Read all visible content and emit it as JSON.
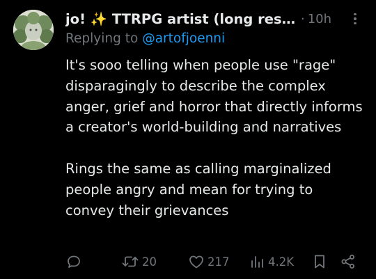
{
  "tweet": {
    "display_name": "jo! ✨ TTRPG artist (long resti...",
    "separator": "·",
    "timestamp": "10h",
    "replying_prefix": "Replying to",
    "replying_handle": "@artofjoenni",
    "paragraphs": [
      "It's sooo telling when people use \"rage\" disparagingly to describe the complex anger, grief and horror that directly informs a creator's world-building and narratives",
      "Rings the same as calling marginalized people angry and mean for trying to convey their grievances"
    ]
  },
  "actions": {
    "reply_icon": "speech-bubble-icon",
    "retweet_icon": "retweet-icon",
    "retweets": "20",
    "like_icon": "heart-icon",
    "likes": "217",
    "views_icon": "bar-chart-icon",
    "views": "4.2K",
    "bookmark_icon": "bookmark-icon",
    "share_icon": "share-icon"
  },
  "colors": {
    "background": "#000000",
    "text": "#e7e9ea",
    "muted": "#71767b",
    "link": "#1d9bf0"
  }
}
